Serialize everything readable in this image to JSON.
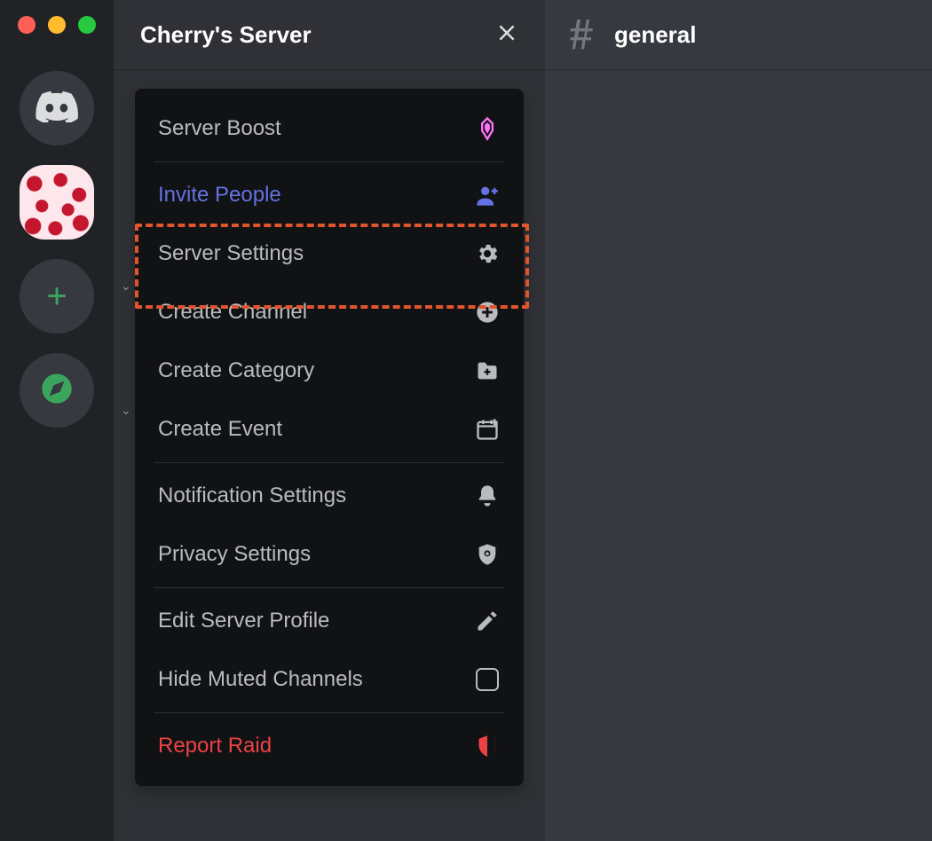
{
  "server": {
    "name": "Cherry's Server"
  },
  "channel": {
    "current_name": "general"
  },
  "menu": {
    "server_boost": "Server Boost",
    "invite_people": "Invite People",
    "server_settings": "Server Settings",
    "create_channel": "Create Channel",
    "create_category": "Create Category",
    "create_event": "Create Event",
    "notification_settings": "Notification Settings",
    "privacy_settings": "Privacy Settings",
    "edit_server_profile": "Edit Server Profile",
    "hide_muted_channels": "Hide Muted Channels",
    "report_raid": "Report Raid"
  },
  "icons": {
    "boost": "boost-gem-icon",
    "invite": "add-user-icon",
    "settings": "gear-icon",
    "create_channel": "plus-circle-icon",
    "create_category": "folder-plus-icon",
    "create_event": "calendar-plus-icon",
    "notifications": "bell-icon",
    "privacy": "shield-star-icon",
    "edit": "pencil-icon",
    "checkbox": "checkbox-empty-icon",
    "report": "shield-alert-icon"
  },
  "highlight": {
    "target": "server_settings"
  },
  "colors": {
    "background_dark": "#202225",
    "background_mid": "#2f3136",
    "background_chat": "#36393f",
    "menu_bg": "#111214",
    "text_normal": "#b9bbbe",
    "text_bright": "#ffffff",
    "blurple": "#6472e4",
    "danger": "#ed4245",
    "green": "#3ba55d",
    "boost_pink": "#ff73fa",
    "highlight_orange": "#e2552c"
  }
}
